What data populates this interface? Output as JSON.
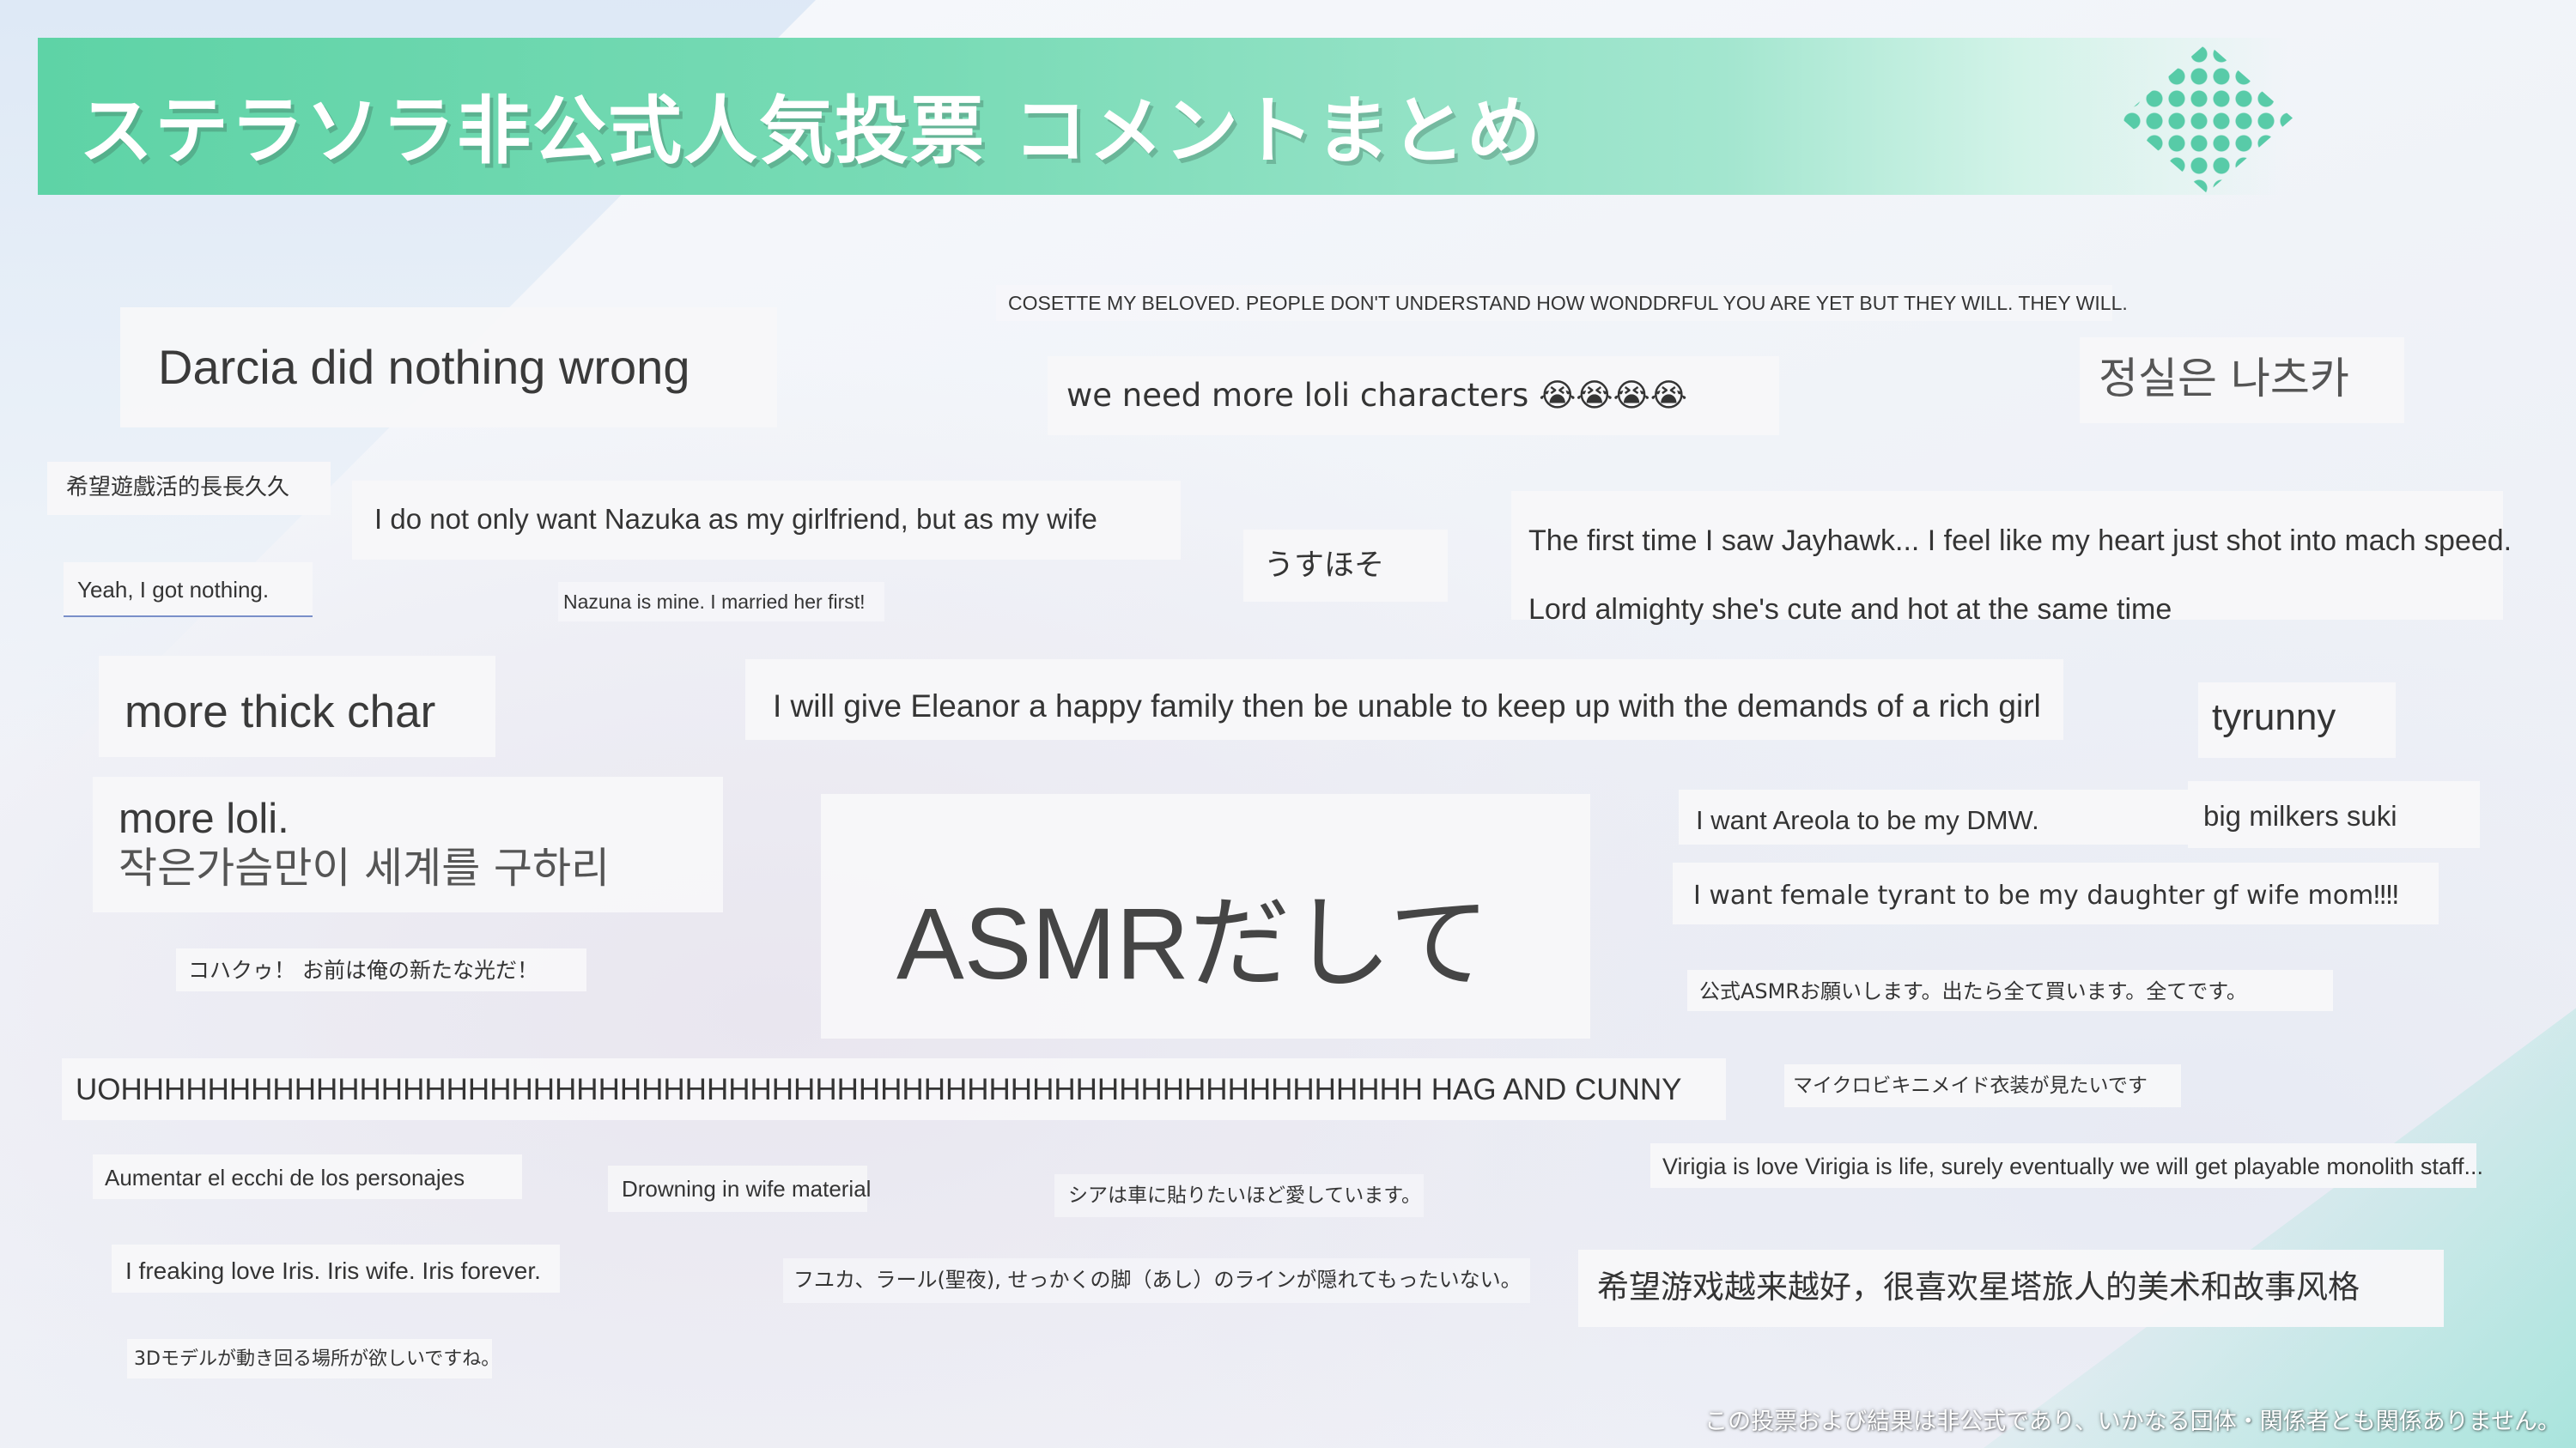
{
  "header": {
    "title": "ステラソラ非公式人気投票 コメントまとめ"
  },
  "comments": {
    "c1": "Darcia did nothing wrong",
    "c2": "COSETTE MY BELOVED. PEOPLE DON'T UNDERSTAND HOW WONDDRFUL YOU ARE YET BUT THEY WILL. THEY WILL.",
    "c3": "we need more loli characters 😭😭😭😭",
    "c4": "정실은 나츠카",
    "c5": "希望遊戲活的長長久久",
    "c6": "I do not only want Nazuka as my girlfriend, but as my wife",
    "c7": "うすほそ",
    "c8": "The first time I saw Jayhawk... I feel like my heart just shot into mach speed.",
    "c9": "Lord almighty she's cute and hot at the same time",
    "c10": "Yeah, I got nothing.",
    "c11": "Nazuna is mine. I married her first!",
    "c12": "more thick char",
    "c13": "I will give Eleanor a happy family then be unable to keep up with the demands of a rich girl",
    "c14": "tyrunny",
    "c15a": "more loli.",
    "c15b": "작은가슴만이 세계를 구하리",
    "c16": "ASMRだして",
    "c17": "I want Areola to be my DMW.",
    "c18": "big milkers suki",
    "c19": "I want female tyrant to be my daughter gf wife mom‼‼",
    "c20": "コハクゥ！ お前は俺の新たな光だ！",
    "c21": "公式ASMRお願いします。出たら全て買います。全てです。",
    "c22": "UOHHHHHHHHHHHHHHHHHHHHHHHHHHHHHHHHHHHHHHHHHHHHHHHHHHHHHHHHHHHH HAG AND CUNNY",
    "c23": "マイクロビキニメイド衣装が見たいです",
    "c24": "Aumentar el ecchi de los personajes",
    "c25": "Drowning in wife material",
    "c26": "シアは車に貼りたいほど愛しています。",
    "c27": "Virigia is love Virigia is life, surely eventually we will get playable monolith staff...",
    "c28": "I freaking love Iris. Iris wife. Iris forever.",
    "c29": "フユカ、ラール(聖夜), せっかくの脚（あし）のラインが隠れてもったいない。",
    "c30": "希望游戏越来越好，很喜欢星塔旅人的美术和故事风格",
    "c31": "3Dモデルが動き回る場所が欲しいですね。"
  },
  "footer": {
    "disclaimer": "この投票および結果は非公式であり、いかなる団体・関係者とも関係ありません。"
  },
  "colors": {
    "header_green": "#5ed3a6",
    "dot_green": "#3ec49a",
    "card_bg": "#f7f7f9",
    "text": "#343434"
  }
}
